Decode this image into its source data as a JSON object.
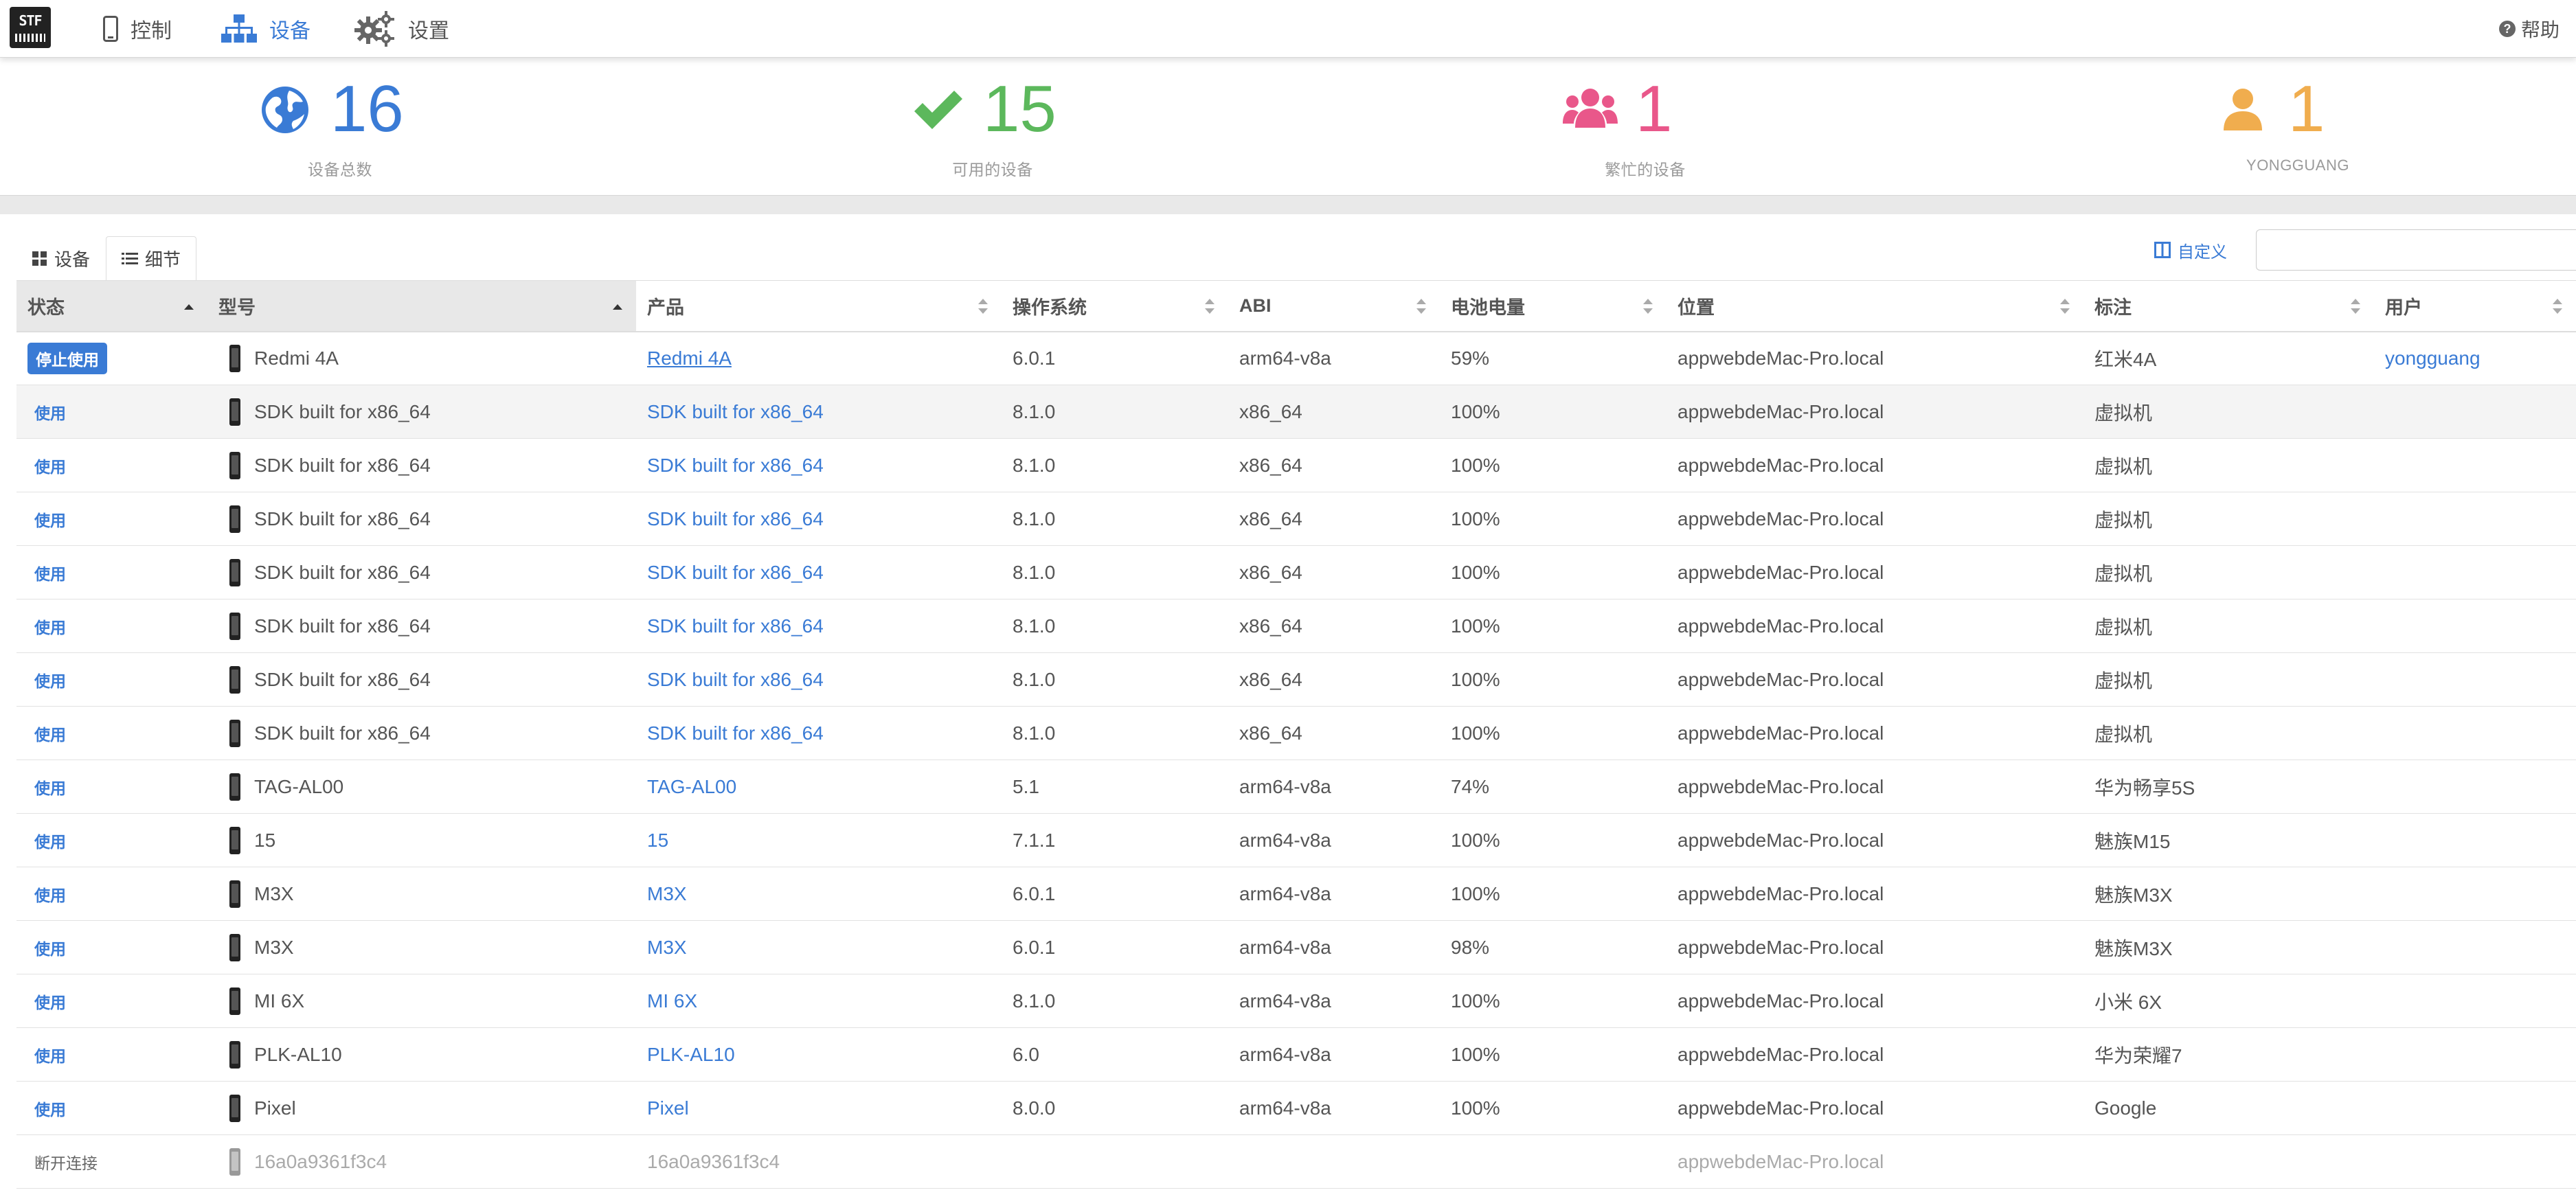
{
  "nav": {
    "logo": "STF",
    "control": "控制",
    "devices": "设备",
    "settings": "设置",
    "help": "帮助"
  },
  "stats": [
    {
      "value": "16",
      "label": "设备总数",
      "icon": "globe-icon"
    },
    {
      "value": "15",
      "label": "可用的设备",
      "icon": "check-icon"
    },
    {
      "value": "1",
      "label": "繁忙的设备",
      "icon": "users-icon"
    },
    {
      "value": "1",
      "label": "YONGGUANG",
      "icon": "user-icon"
    }
  ],
  "tabs": {
    "devices": "设备",
    "details": "细节"
  },
  "customize": "自定义",
  "columns": [
    "状态",
    "型号",
    "产品",
    "操作系统",
    "ABI",
    "电池电量",
    "位置",
    "标注",
    "用户"
  ],
  "rows": [
    {
      "status": "停止使用",
      "model": "Redmi 4A",
      "product": "Redmi 4A",
      "os": "6.0.1",
      "abi": "arm64-v8a",
      "battery": "59%",
      "location": "appwebdeMac-Pro.local",
      "note": "红米4A",
      "user": "yongguang"
    },
    {
      "status": "使用",
      "model": "SDK built for x86_64",
      "product": "SDK built for x86_64",
      "os": "8.1.0",
      "abi": "x86_64",
      "battery": "100%",
      "location": "appwebdeMac-Pro.local",
      "note": "虚拟机",
      "user": ""
    },
    {
      "status": "使用",
      "model": "SDK built for x86_64",
      "product": "SDK built for x86_64",
      "os": "8.1.0",
      "abi": "x86_64",
      "battery": "100%",
      "location": "appwebdeMac-Pro.local",
      "note": "虚拟机",
      "user": ""
    },
    {
      "status": "使用",
      "model": "SDK built for x86_64",
      "product": "SDK built for x86_64",
      "os": "8.1.0",
      "abi": "x86_64",
      "battery": "100%",
      "location": "appwebdeMac-Pro.local",
      "note": "虚拟机",
      "user": ""
    },
    {
      "status": "使用",
      "model": "SDK built for x86_64",
      "product": "SDK built for x86_64",
      "os": "8.1.0",
      "abi": "x86_64",
      "battery": "100%",
      "location": "appwebdeMac-Pro.local",
      "note": "虚拟机",
      "user": ""
    },
    {
      "status": "使用",
      "model": "SDK built for x86_64",
      "product": "SDK built for x86_64",
      "os": "8.1.0",
      "abi": "x86_64",
      "battery": "100%",
      "location": "appwebdeMac-Pro.local",
      "note": "虚拟机",
      "user": ""
    },
    {
      "status": "使用",
      "model": "SDK built for x86_64",
      "product": "SDK built for x86_64",
      "os": "8.1.0",
      "abi": "x86_64",
      "battery": "100%",
      "location": "appwebdeMac-Pro.local",
      "note": "虚拟机",
      "user": ""
    },
    {
      "status": "使用",
      "model": "SDK built for x86_64",
      "product": "SDK built for x86_64",
      "os": "8.1.0",
      "abi": "x86_64",
      "battery": "100%",
      "location": "appwebdeMac-Pro.local",
      "note": "虚拟机",
      "user": ""
    },
    {
      "status": "使用",
      "model": "TAG-AL00",
      "product": "TAG-AL00",
      "os": "5.1",
      "abi": "arm64-v8a",
      "battery": "74%",
      "location": "appwebdeMac-Pro.local",
      "note": "华为畅享5S",
      "user": ""
    },
    {
      "status": "使用",
      "model": "15",
      "product": "15",
      "os": "7.1.1",
      "abi": "arm64-v8a",
      "battery": "100%",
      "location": "appwebdeMac-Pro.local",
      "note": "魅族M15",
      "user": ""
    },
    {
      "status": "使用",
      "model": "M3X",
      "product": "M3X",
      "os": "6.0.1",
      "abi": "arm64-v8a",
      "battery": "100%",
      "location": "appwebdeMac-Pro.local",
      "note": "魅族M3X",
      "user": ""
    },
    {
      "status": "使用",
      "model": "M3X",
      "product": "M3X",
      "os": "6.0.1",
      "abi": "arm64-v8a",
      "battery": "98%",
      "location": "appwebdeMac-Pro.local",
      "note": "魅族M3X",
      "user": ""
    },
    {
      "status": "使用",
      "model": "MI 6X",
      "product": "MI 6X",
      "os": "8.1.0",
      "abi": "arm64-v8a",
      "battery": "100%",
      "location": "appwebdeMac-Pro.local",
      "note": "小米 6X",
      "user": ""
    },
    {
      "status": "使用",
      "model": "PLK-AL10",
      "product": "PLK-AL10",
      "os": "6.0",
      "abi": "arm64-v8a",
      "battery": "100%",
      "location": "appwebdeMac-Pro.local",
      "note": "华为荣耀7",
      "user": ""
    },
    {
      "status": "使用",
      "model": "Pixel",
      "product": "Pixel",
      "os": "8.0.0",
      "abi": "arm64-v8a",
      "battery": "100%",
      "location": "appwebdeMac-Pro.local",
      "note": "Google",
      "user": ""
    },
    {
      "status": "断开连接",
      "model": "16a0a9361f3c4",
      "product": "16a0a9361f3c4",
      "os": "",
      "abi": "",
      "battery": "",
      "location": "appwebdeMac-Pro.local",
      "note": "",
      "user": ""
    }
  ]
}
